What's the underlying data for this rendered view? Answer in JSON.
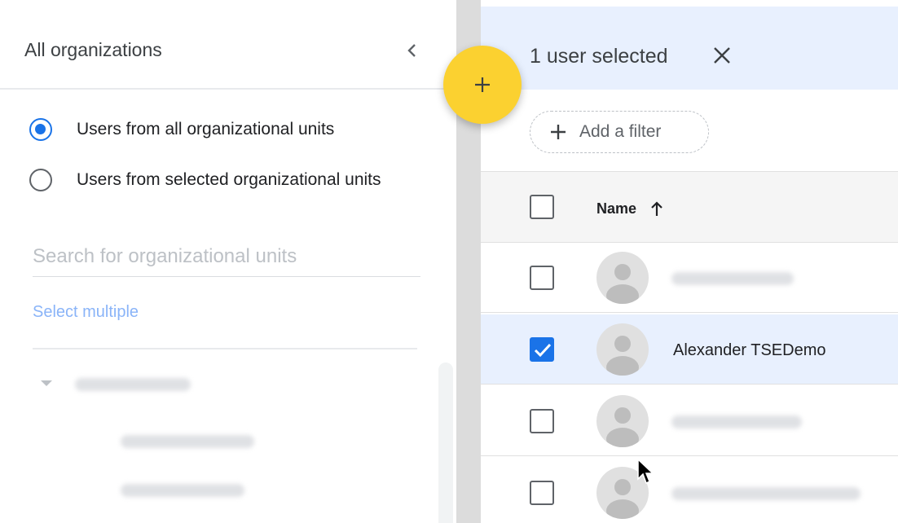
{
  "sidebar": {
    "title": "All organizations",
    "collapse_icon": "chevron-left-icon",
    "scope_options": [
      {
        "label": "Users from all organizational units",
        "selected": true
      },
      {
        "label": "Users from selected organizational units",
        "selected": false
      }
    ],
    "search_placeholder": "Search for organizational units",
    "select_multiple_label": "Select multiple",
    "tree_icon": "caret-down-icon"
  },
  "fab": {
    "icon": "plus-icon",
    "color": "#fbd130"
  },
  "selection_bar": {
    "text": "1 user selected",
    "close_icon": "close-icon",
    "background": "#e8f0fe"
  },
  "filter": {
    "icon": "plus-icon",
    "label": "Add a filter"
  },
  "table": {
    "columns": [
      {
        "label": "Name",
        "sort": "ascending",
        "sort_icon": "arrow-up-icon"
      }
    ],
    "rows": [
      {
        "name": "",
        "checked": false,
        "redacted": true
      },
      {
        "name": "Alexander TSEDemo",
        "checked": true,
        "redacted": false
      },
      {
        "name": "",
        "checked": false,
        "redacted": true
      },
      {
        "name": "",
        "checked": false,
        "redacted": true
      }
    ]
  },
  "accent_color": "#1a73e8"
}
